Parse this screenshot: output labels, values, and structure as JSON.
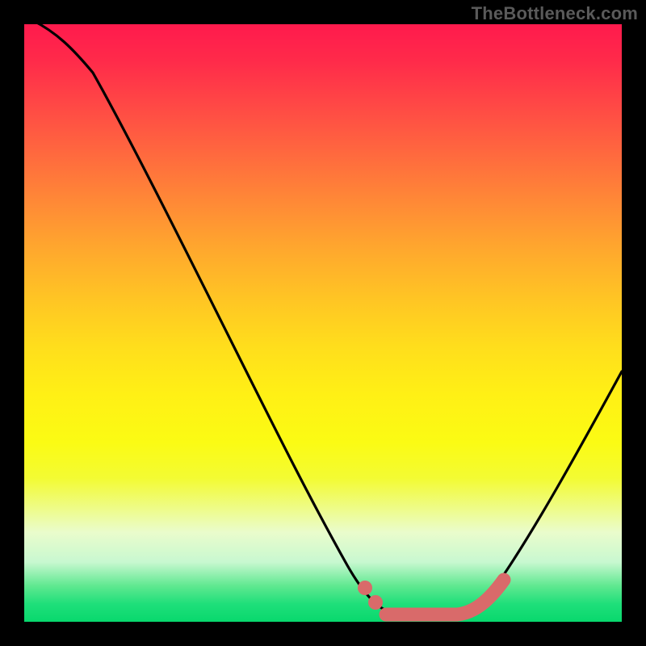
{
  "watermark": "TheBottleneck.com",
  "chart_data": {
    "type": "line",
    "title": "",
    "xlabel": "",
    "ylabel": "",
    "xlim": [
      0,
      100
    ],
    "ylim": [
      0,
      100
    ],
    "series": [
      {
        "name": "bottleneck-curve",
        "x": [
          0,
          6,
          12,
          18,
          24,
          30,
          36,
          42,
          48,
          52,
          56,
          60,
          64,
          68,
          72,
          76,
          80,
          85,
          90,
          95,
          100
        ],
        "values": [
          100,
          98,
          91,
          82,
          72,
          61,
          50,
          39,
          27,
          18,
          10,
          4,
          1,
          0,
          0,
          1,
          4,
          10,
          20,
          32,
          46
        ]
      }
    ],
    "optimal_range": {
      "x_start": 60,
      "x_end": 76
    },
    "gradient_stops": [
      {
        "pct": 0,
        "color": "#ff1a4d"
      },
      {
        "pct": 50,
        "color": "#ffde1c"
      },
      {
        "pct": 100,
        "color": "#08d86d"
      }
    ]
  }
}
